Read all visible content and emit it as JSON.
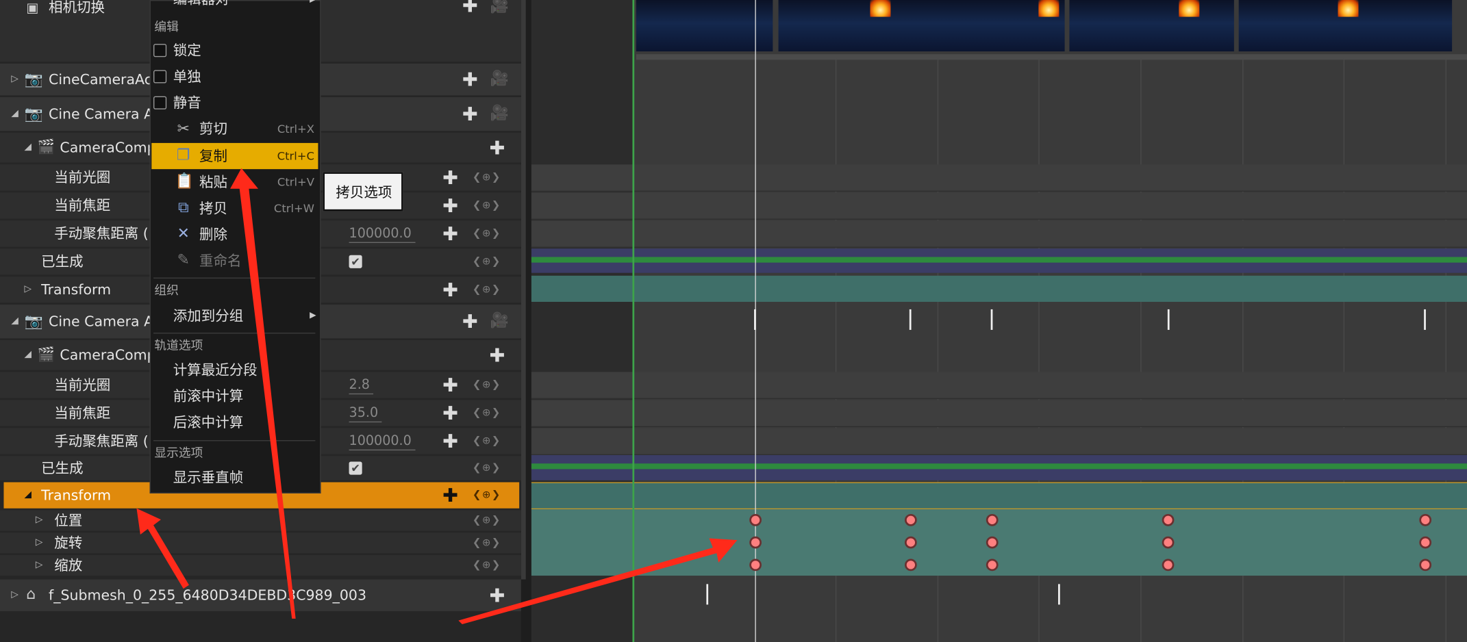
{
  "outliner": {
    "camera_cut": "相机切换",
    "actor_1": "CineCameraAct",
    "actor_2": "Cine Camera Ac",
    "camera_comp": "CameraComp",
    "aperture": "当前光圈",
    "focal_length": "当前焦距",
    "manual_focus": "手动聚焦距离 (",
    "spawned": "已生成",
    "transform": "Transform",
    "actor_3": "Cine Camera Ac",
    "aperture_value": "2.8",
    "focal_value": "35.0",
    "focus_value_1": "100000.0",
    "focus_value_2": "100000.0",
    "location": "位置",
    "rotation": "旋转",
    "scale": "缩放",
    "submesh": "f_Submesh_0_255_6480D34DEBD3C989_003",
    "add_glyph": "✚",
    "nav_glyph": "❮⊕❯"
  },
  "context_menu": {
    "top_item": "编辑器对",
    "section_edit": "编辑",
    "lock": "锁定",
    "solo": "单独",
    "mute": "静音",
    "cut": "剪切",
    "cut_shortcut": "Ctrl+X",
    "copy": "复制",
    "copy_shortcut": "Ctrl+C",
    "paste": "粘贴",
    "paste_shortcut": "Ctrl+V",
    "duplicate": "拷贝",
    "duplicate_shortcut": "Ctrl+W",
    "delete": "删除",
    "rename": "重命名",
    "section_organize": "组织",
    "add_to_group": "添加到分组",
    "section_track": "轨道选项",
    "eval_nearest": "计算最近分段",
    "pre_roll": "前滚中计算",
    "post_roll": "后滚中计算",
    "section_display": "显示选项",
    "show_vertical_frames": "显示垂直帧"
  },
  "tooltip": {
    "text": "拷贝选项"
  },
  "icons": {
    "cut": "scissors-icon",
    "copy": "copy-icon",
    "paste": "clipboard-icon",
    "duplicate": "duplicate-icon",
    "delete": "x-icon",
    "rename": "rename-icon",
    "camera": "camera-icon",
    "movie_camera": "movie-camera-icon",
    "submesh": "mesh-icon"
  },
  "colors": {
    "selection": "#e08a0c",
    "menu_highlight": "#e6ac00",
    "keyframe": "#ff8080",
    "track_teal": "#3f6f69",
    "annotation_arrow": "#ff2a1a"
  }
}
